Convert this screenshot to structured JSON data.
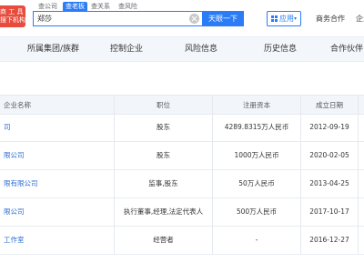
{
  "header": {
    "logo_line1": "商 工 具",
    "logo_line2": "搜下机构",
    "search_tabs": [
      "查公司",
      "查老板",
      "查关系",
      "查风险"
    ],
    "active_tab_index": 1,
    "search_value": "郑莎",
    "search_button": "天眼一下",
    "app_button": "应用",
    "nav_business": "商务合作",
    "nav_more": "企业"
  },
  "section_tabs": [
    "所属集团/族群",
    "控制企业",
    "风险信息",
    "历史信息",
    "合作伙伴"
  ],
  "table": {
    "headers": [
      "企业名称",
      "职位",
      "注册资本",
      "成立日期"
    ],
    "rows": [
      {
        "name": "司",
        "position": "股东",
        "capital": "4289.8315万人民币",
        "date": "2012-09-19"
      },
      {
        "name": "限公司",
        "position": "股东",
        "capital": "1000万人民币",
        "date": "2020-02-05"
      },
      {
        "name": "限有限公司",
        "position": "监事,股东",
        "capital": "50万人民币",
        "date": "2013-04-25"
      },
      {
        "name": "限公司",
        "position": "执行董事,经理,法定代表人",
        "capital": "500万人民币",
        "date": "2017-10-17"
      },
      {
        "name": "工作室",
        "position": "经营者",
        "capital": "-",
        "date": "2016-12-27"
      }
    ]
  },
  "colors": {
    "accent": "#2b7cf6",
    "logo_red": "#e74c3c",
    "link": "#2b6cd4",
    "tab_bg": "#f3f7fc"
  }
}
